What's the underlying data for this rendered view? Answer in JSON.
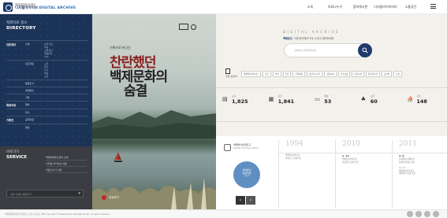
{
  "header": {
    "logo_sub": "백제세계유산센터",
    "logo_main_ko": "디지털아카이브",
    "logo_main_en": "DIGITAL ARCHIVE",
    "nav": [
      "소개",
      "자료나누기",
      "참여게시판",
      "디지털라이브러리",
      "소통공간"
    ]
  },
  "directory": {
    "title_ko": "백제자료 정보",
    "title_en": "DIRECTORY",
    "rows": [
      {
        "cat": "인문정보",
        "sub": "출처",
        "items": "정치·외교\n의례\n교통·통신\n생활문화\nS/W"
      },
      {
        "cat": "",
        "sub": "보조자료",
        "items": "고서\n문헌\n사진\n영상\n도면"
      },
      {
        "cat": "",
        "sub": "발굴조사",
        "items": ""
      },
      {
        "cat": "",
        "sub": "세계유산",
        "items": ""
      },
      {
        "cat": "",
        "sub": "기타",
        "items": ""
      },
      {
        "cat": "특화자료",
        "sub": "목차",
        "items": ""
      },
      {
        "cat": "",
        "sub": "전시",
        "items": ""
      },
      {
        "cat": "기획전",
        "sub": "공개자료",
        "items": ""
      },
      {
        "cat": "",
        "sub": "영상",
        "items": ""
      }
    ]
  },
  "service": {
    "title_ko": "바로가기",
    "title_en": "SERVICE",
    "items": [
      "백제세계유산센터 안내",
      "디지털 아카이브 이용",
      "자료나누기 신청"
    ],
    "select_placeholder": "관련 사이트 바로가기"
  },
  "photo": {
    "quote": "기록으로 만나는",
    "calli_line1": "찬란했던",
    "calli_line2": "백제문화의",
    "calli_line3": "숨결",
    "label": "공유하기"
  },
  "main": {
    "archive_title": "DIGITAL ARCHIVE",
    "archive_desc_bold": "백제유산",
    "archive_desc_rest": ", 이제 한곳에서 모두 누리고 찾아보세요",
    "search_placeholder": "검색어를 입력해주세요",
    "tags_label": "추천 검색어",
    "tags": [
      "백제역사유적지구",
      "공주",
      "부여",
      "익산",
      "무령왕릉",
      "송산리고분군",
      "정림사지",
      "부소산성",
      "미륵사지",
      "왕궁리유적",
      "공산성",
      "나성",
      "능산리고분군"
    ],
    "stats": [
      {
        "icon": "book-icon",
        "label": "도서",
        "value": "1,825"
      },
      {
        "icon": "doc-icon",
        "label": "사진",
        "value": "1,841"
      },
      {
        "icon": "video-icon",
        "label": "영상",
        "value": "53"
      },
      {
        "icon": "dance-icon",
        "label": "도면",
        "value": "60"
      },
      {
        "icon": "ship-icon",
        "label": "기타",
        "value": "148"
      }
    ]
  },
  "history": {
    "brand_ko": "백제역사유적지구",
    "brand_en": "BAEKJE HISTORIC AREAS",
    "circle_title": "세계유산\n등재과정",
    "circle_sub": "더보기",
    "timeline": [
      {
        "year": "1994",
        "date": "",
        "text": "백제역사유적지구\n유네스코 잠정목록"
      },
      {
        "year": "2010",
        "date": "1. 11.",
        "text": "백제역사유적지구\n잠정목록 등재 추진"
      },
      {
        "year": "2011",
        "date": "3. 6.",
        "text": "문화재청 세계유산\n등재추진대상 선정\n\n11. 11.\n백제역사유적지구\n세계유산 등재 신청"
      }
    ]
  },
  "footer": {
    "text": "백제세계유산센터  충청남도 공주시 웅진로 280  Copyright © Baekje World Heritage Center. All rights reserved."
  }
}
